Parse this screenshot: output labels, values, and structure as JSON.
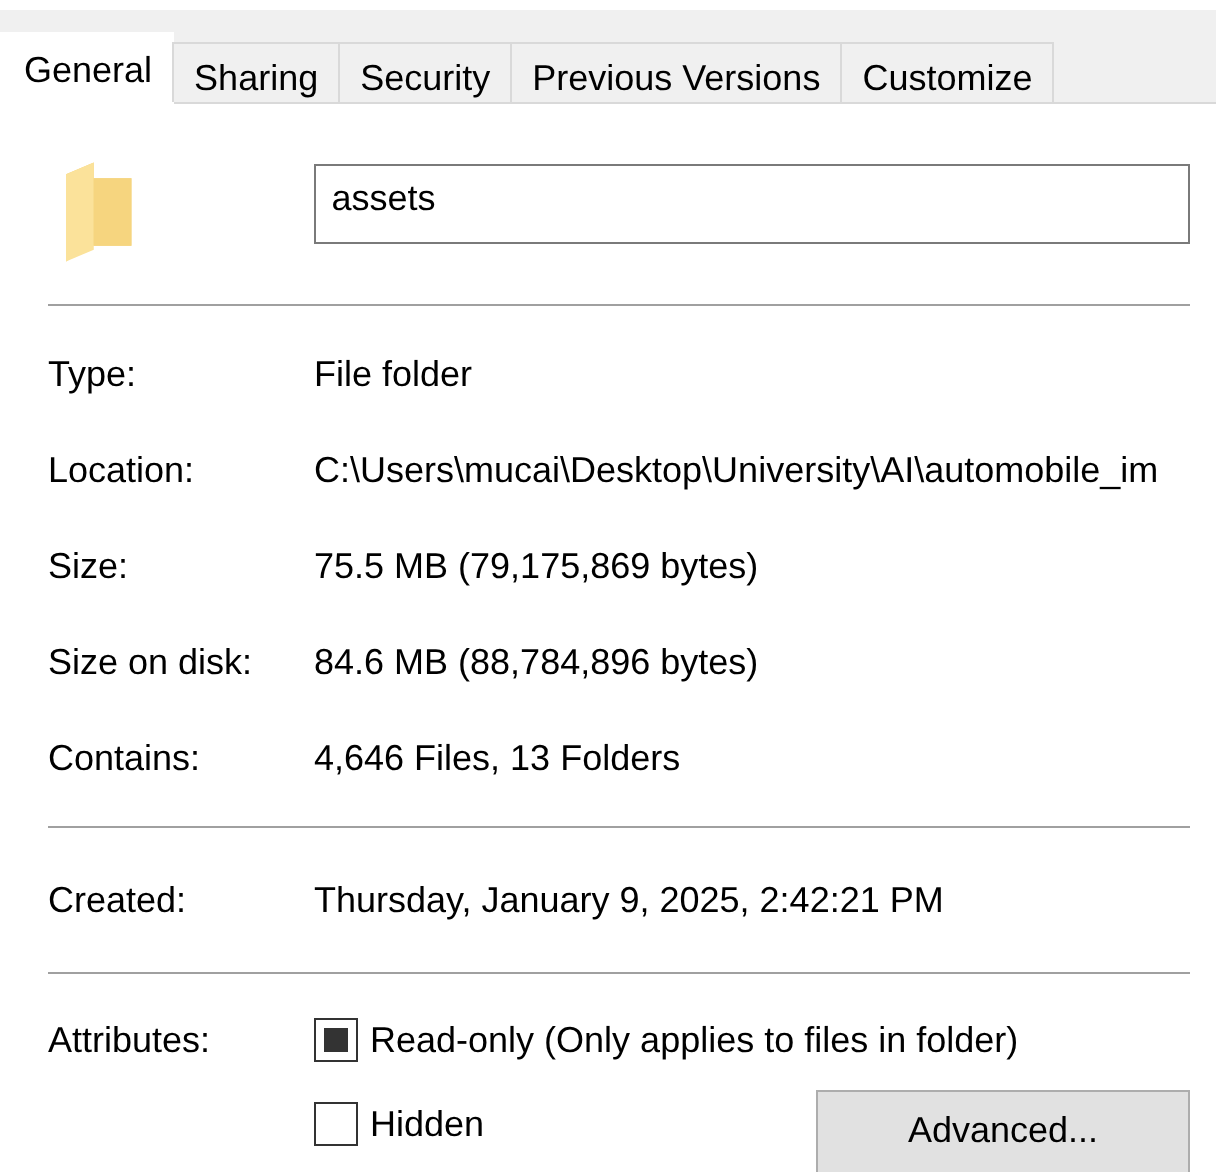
{
  "tabs": [
    {
      "label": "General",
      "selected": true
    },
    {
      "label": "Sharing",
      "selected": false
    },
    {
      "label": "Security",
      "selected": false
    },
    {
      "label": "Previous Versions",
      "selected": false
    },
    {
      "label": "Customize",
      "selected": false
    }
  ],
  "name_field": {
    "value": "assets"
  },
  "details": [
    {
      "label": "Type:",
      "value": "File folder"
    },
    {
      "label": "Location:",
      "value": "C:\\Users\\mucai\\Desktop\\University\\AI\\automobile_im"
    },
    {
      "label": "Size:",
      "value": "75.5 MB (79,175,869 bytes)"
    },
    {
      "label": "Size on disk:",
      "value": "84.6 MB (88,784,896 bytes)"
    },
    {
      "label": "Contains:",
      "value": "4,646 Files, 13 Folders"
    }
  ],
  "created": {
    "label": "Created:",
    "value": "Thursday, January 9, 2025, 2:42:21 PM"
  },
  "attributes": {
    "label": "Attributes:",
    "options": [
      {
        "label": "Read-only (Only applies to files in folder)",
        "checked": false,
        "indeterminate": true
      },
      {
        "label": "Hidden",
        "checked": false,
        "indeterminate": false
      }
    ],
    "advanced_button": "Advanced..."
  }
}
